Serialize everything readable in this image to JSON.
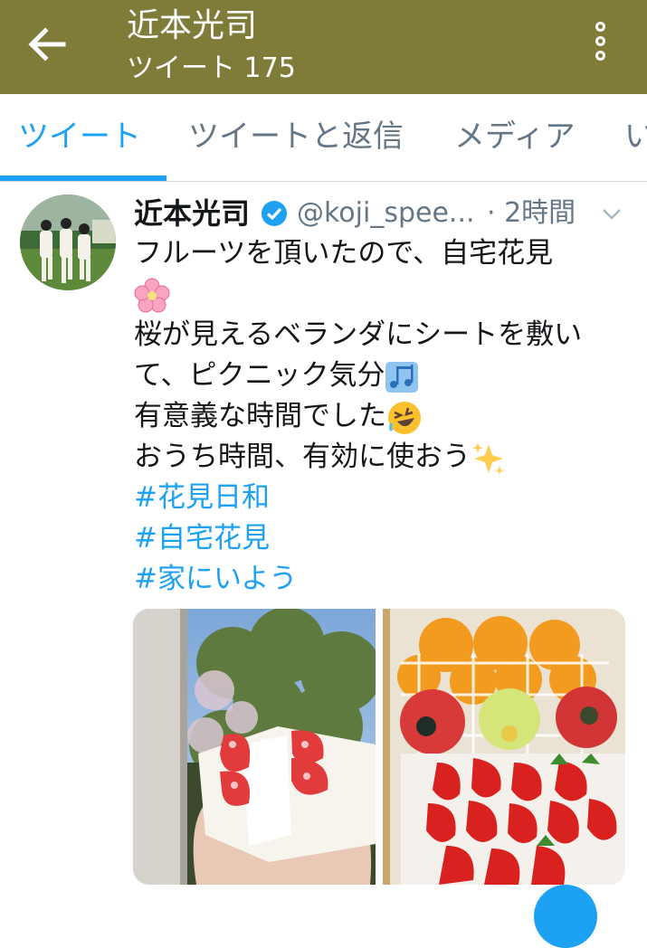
{
  "header": {
    "title": "近本光司",
    "subtitle": "ツイート 175",
    "back_icon": "arrow-left-icon",
    "menu_icon": "more-vertical-icon",
    "background_color": "#7e7c38"
  },
  "tabs": [
    {
      "label": "ツイート",
      "active": true
    },
    {
      "label": "ツイートと返信",
      "active": false
    },
    {
      "label": "メディア",
      "active": false
    },
    {
      "label": "い",
      "active": false
    }
  ],
  "tweet": {
    "author": "近本光司",
    "handle": "@koji_spee...",
    "time": "· 2時間",
    "verified": true,
    "lines": [
      "フルーツを頂いたので、自宅花見",
      "桜が見えるベランダにシートを敷い",
      "て、ピクニック気分",
      "有意義な時間でした",
      "おうち時間、有効に使おう"
    ],
    "hashtags": [
      "#花見日和",
      "#自宅花見",
      "#家にいよう"
    ],
    "emojis": [
      "cherry-blossom",
      "musical-notes",
      "rolling-laughing",
      "sparkles"
    ]
  },
  "colors": {
    "accent": "#1da1f2",
    "secondary_text": "#657786"
  }
}
